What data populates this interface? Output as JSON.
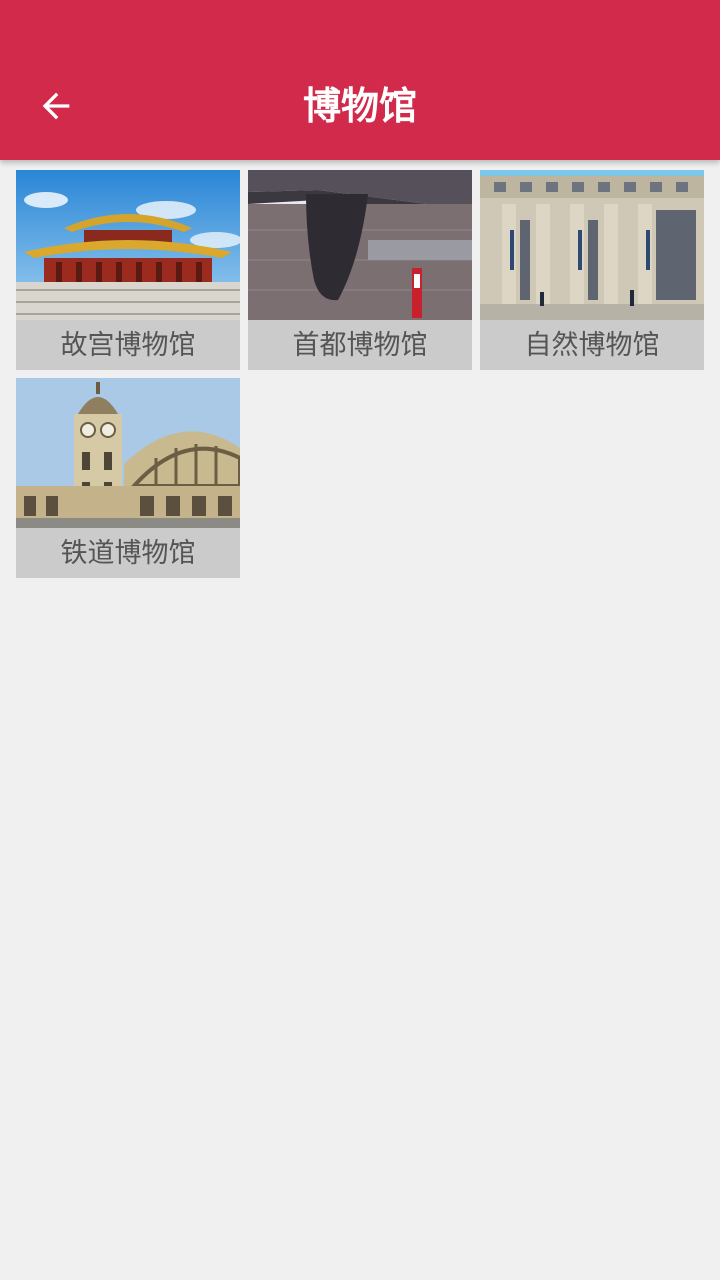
{
  "appbar": {
    "title": "博物馆",
    "back_icon": "arrow-left-icon",
    "background": "#d12a4a"
  },
  "museums": [
    {
      "name": "故宫博物馆",
      "image": "forbidden-city-palace-photo"
    },
    {
      "name": "首都博物馆",
      "image": "capital-museum-photo"
    },
    {
      "name": "自然博物馆",
      "image": "natural-history-museum-photo"
    },
    {
      "name": "铁道博物馆",
      "image": "railway-museum-photo"
    }
  ]
}
